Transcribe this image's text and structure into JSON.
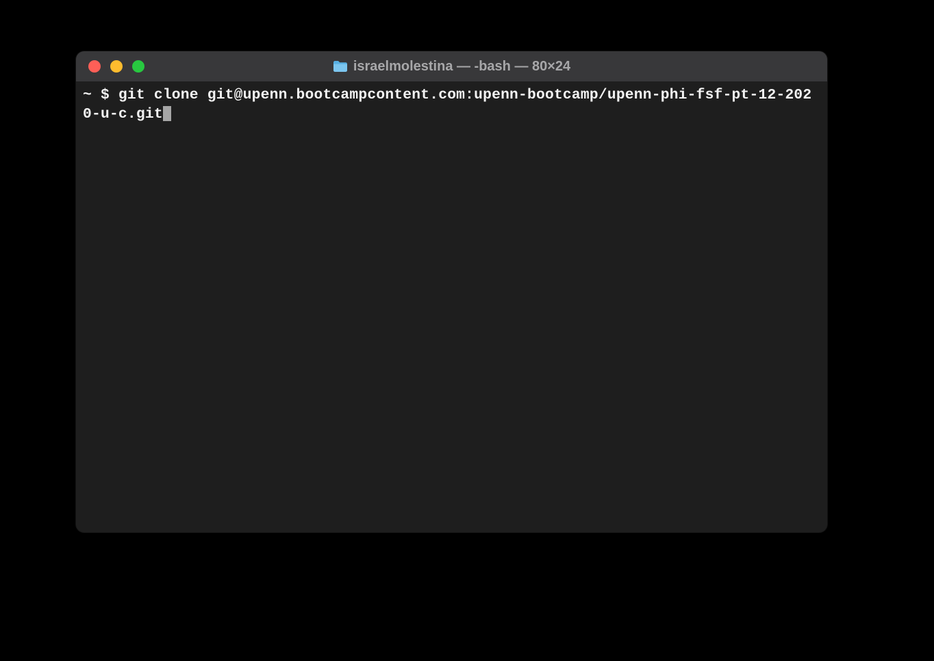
{
  "window": {
    "title": "israelmolestina — -bash — 80×24",
    "icon_name": "folder"
  },
  "terminal": {
    "prompt": "~ $ ",
    "command": "git clone git@upenn.bootcampcontent.com:upenn-bootcamp/upenn-phi-fsf-pt-12-2020-u-c.git"
  },
  "colors": {
    "close": "#ff5f57",
    "minimize": "#febc2e",
    "zoom": "#28c840",
    "titlebar_bg": "#38383a",
    "body_bg": "#1e1e1e",
    "text": "#f3f3f3"
  }
}
